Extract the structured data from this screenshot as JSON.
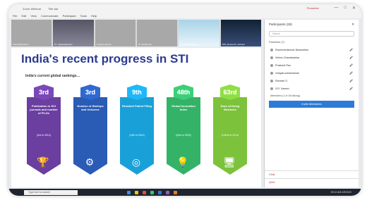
{
  "window": {
    "app_title": "Zoom Webinar",
    "menu_extra": "Title bar",
    "user_label": "Presenter",
    "controls": [
      "—",
      "□",
      "✕"
    ]
  },
  "menu": [
    "File",
    "Edit",
    "View",
    "Communicate",
    "Participant",
    "Tools",
    "Help"
  ],
  "video_tiles": [
    {
      "name": "Ananthakrishnan",
      "style": "plain"
    },
    {
      "name": "Pr. Vijayaraghavan",
      "style": "cam1"
    },
    {
      "name": "vinayak.rajanna",
      "style": "plain"
    },
    {
      "name": "Dr. Ravikumar",
      "style": "plain"
    },
    {
      "name": "Dr. Suma Natarajan",
      "style": "cam2"
    },
    {
      "name": "PhD_Research_Scholar",
      "style": "cam3"
    }
  ],
  "slide": {
    "title": "India's recent progress in STI",
    "subtitle": "India's current global rankings…",
    "columns": [
      {
        "rank": "3rd",
        "text": "Publication in SCI journals and number of Ph.Ds",
        "year": "(3rd in 2014)",
        "icon": "🏆",
        "color": "#6a3fa0"
      },
      {
        "rank": "3rd",
        "text": "Number of Startups and Unicorns",
        "year": "",
        "icon": "⚙",
        "color": "#2a5bb5"
      },
      {
        "rank": "9th",
        "text": "Resident Patent Filing",
        "year": "(13th in 2014)",
        "icon": "◎",
        "color": "#1aa0d8"
      },
      {
        "rank": "48th",
        "text": "Global Innovation Index",
        "year": "(81st in 2015)",
        "icon": "💡",
        "color": "#34b368"
      },
      {
        "rank": "63rd",
        "text": "Ease of Doing Business",
        "year": "(142nd in 2014)",
        "icon": "🖥",
        "color": "#7cc23b"
      }
    ]
  },
  "participants": {
    "header": "Participants (25)",
    "search_placeholder": "Search",
    "section": "Panelists (7)",
    "rows": [
      {
        "name": "Raveendrakumar Banavathar",
        "mic": "🎤"
      },
      {
        "name": "Vishnu Chandavarkar",
        "mic": "🎤"
      },
      {
        "name": "Prashant Rao",
        "mic": "🎤"
      },
      {
        "name": "vinayak.subramanian",
        "mic": "🎤"
      },
      {
        "name": "Ramesh S.",
        "mic": "🎤"
      },
      {
        "name": "S.R. Naresh",
        "mic": "🎤"
      }
    ],
    "meeting_label": "Attendees (1 of 18 talking)",
    "button": "Invite Attendees",
    "chat": "Chat",
    "qa": "Q&A"
  },
  "taskbar": {
    "search": "Type here to search",
    "time": "09:12 AM",
    "date": "4/9/2022"
  }
}
